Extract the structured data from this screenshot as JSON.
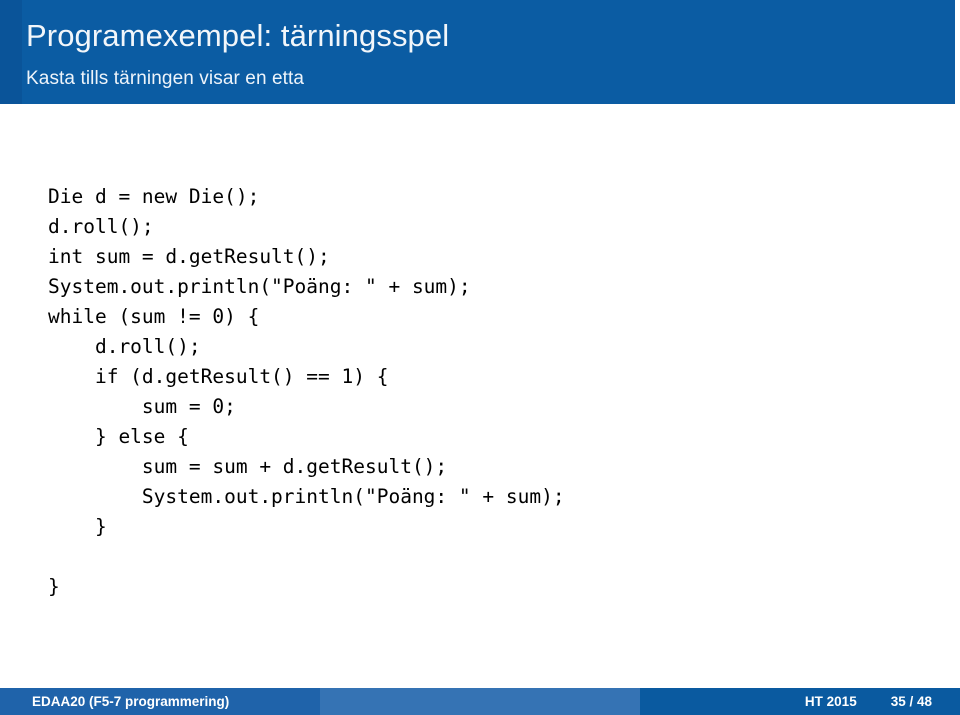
{
  "slide": {
    "title": "Programexempel: tärningsspel",
    "subtitle": "Kasta tills tärningen visar en etta",
    "accent_color": "#0b5ca3",
    "code": {
      "language": "java",
      "lines": [
        "Die d = new Die();",
        "d.roll();",
        "int sum = d.getResult();",
        "System.out.println(\"Poäng: \" + sum);",
        "while (sum != 0) {",
        "    d.roll();",
        "    if (d.getResult() == 1) {",
        "        sum = 0;",
        "    } else {",
        "        sum = sum + d.getResult();",
        "        System.out.println(\"Poäng: \" + sum);",
        "    }",
        "",
        "}"
      ]
    }
  },
  "footer": {
    "course": "EDAA20  (F5-7 programmering)",
    "term": "HT 2015",
    "page": "35 / 48",
    "left_color": "#1f63aa",
    "middle_color": "#3573b4",
    "right_color": "#0a5aa0"
  }
}
